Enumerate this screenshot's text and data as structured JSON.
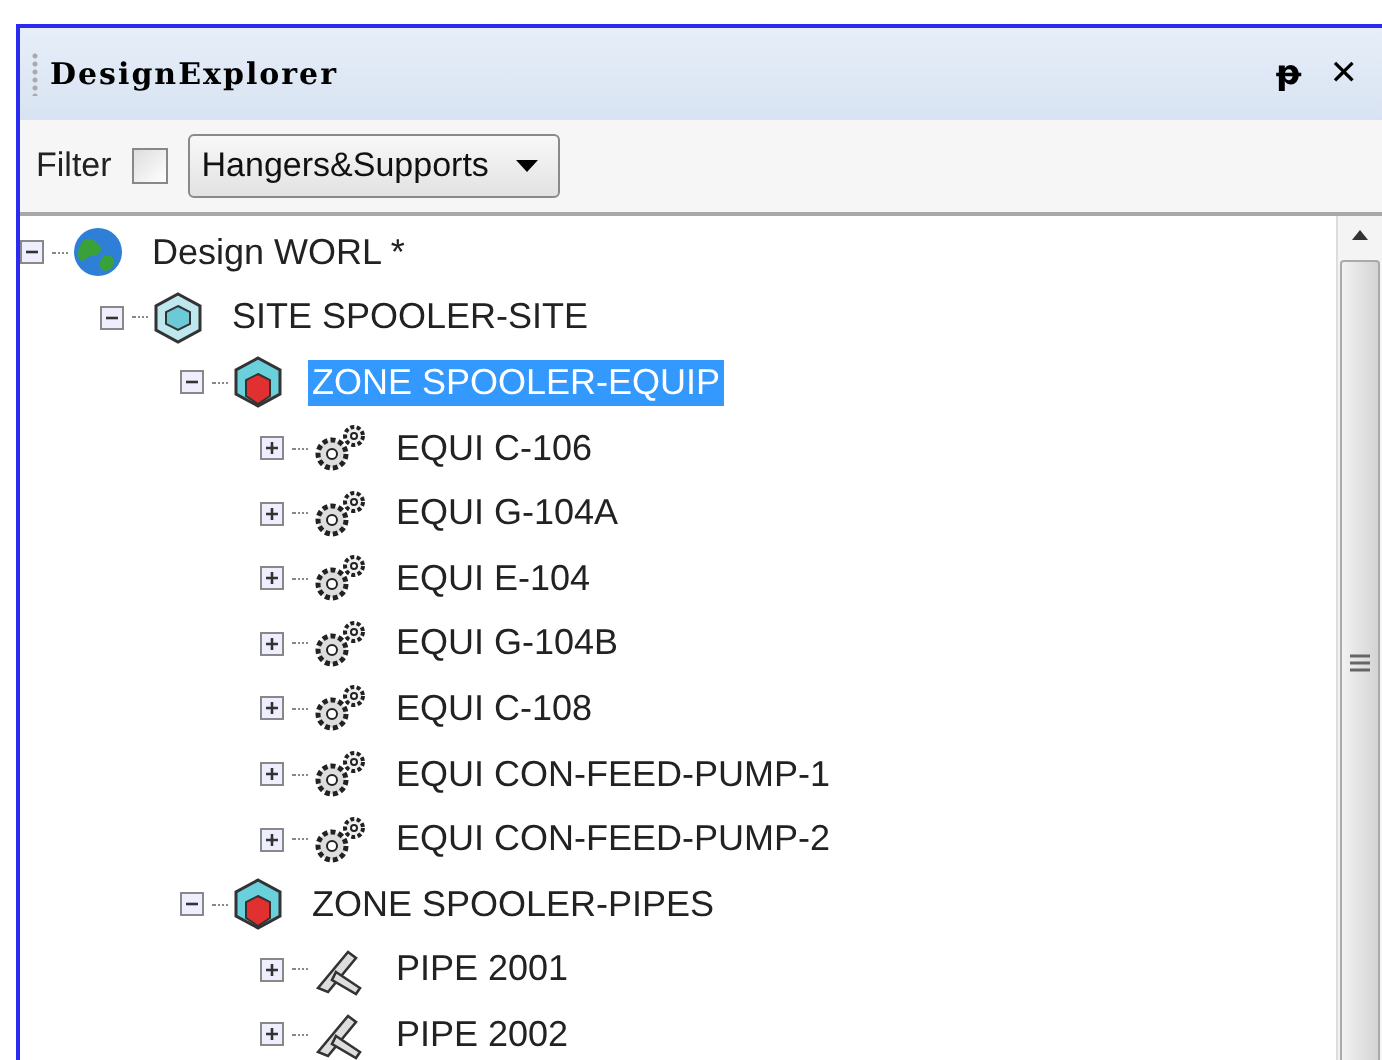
{
  "panel": {
    "title": "DesignExplorer",
    "pin": "ᵽ",
    "close": "✕"
  },
  "filter": {
    "label": "Filter",
    "checked": false,
    "value": "Hangers&Supports"
  },
  "tree": [
    {
      "label": "Design WORL *",
      "kind": "world",
      "expanded": true,
      "selected": false,
      "children": [
        {
          "label": "SITE SPOOLER-SITE",
          "kind": "site",
          "expanded": true,
          "selected": false,
          "children": [
            {
              "label": "ZONE SPOOLER-EQUIP",
              "kind": "zone",
              "expanded": true,
              "selected": true,
              "children": [
                {
                  "label": "EQUI C-106",
                  "kind": "equipment",
                  "expanded": false,
                  "selected": false
                },
                {
                  "label": "EQUI G-104A",
                  "kind": "equipment",
                  "expanded": false,
                  "selected": false
                },
                {
                  "label": "EQUI E-104",
                  "kind": "equipment",
                  "expanded": false,
                  "selected": false
                },
                {
                  "label": "EQUI G-104B",
                  "kind": "equipment",
                  "expanded": false,
                  "selected": false
                },
                {
                  "label": "EQUI C-108",
                  "kind": "equipment",
                  "expanded": false,
                  "selected": false
                },
                {
                  "label": "EQUI CON-FEED-PUMP-1",
                  "kind": "equipment",
                  "expanded": false,
                  "selected": false
                },
                {
                  "label": "EQUI CON-FEED-PUMP-2",
                  "kind": "equipment",
                  "expanded": false,
                  "selected": false
                }
              ]
            },
            {
              "label": "ZONE SPOOLER-PIPES",
              "kind": "zone",
              "expanded": true,
              "selected": false,
              "children": [
                {
                  "label": "PIPE 2001",
                  "kind": "pipe",
                  "expanded": false,
                  "selected": false
                },
                {
                  "label": "PIPE 2002",
                  "kind": "pipe",
                  "expanded": false,
                  "selected": false
                }
              ]
            }
          ]
        }
      ]
    }
  ]
}
